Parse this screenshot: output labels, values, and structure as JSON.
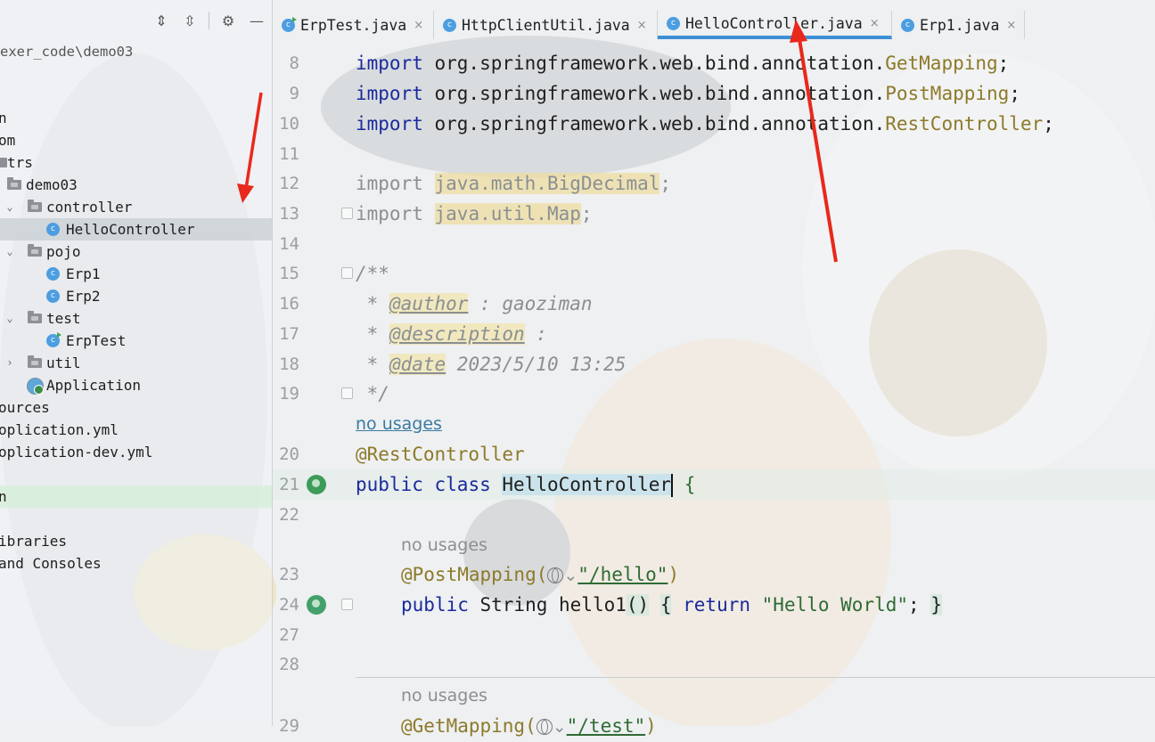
{
  "project": {
    "path": "exer_code\\demo03",
    "toolbar": {
      "expand_icon": "expand-all-icon",
      "collapse_icon": "collapse-all-icon",
      "settings_icon": "gear-icon",
      "hide_icon": "minimize-icon"
    },
    "tree": [
      {
        "label": "n",
        "depth": 0
      },
      {
        "label": "om",
        "depth": 0
      },
      {
        "label": "trs",
        "depth": 0
      },
      {
        "label": "demo03",
        "depth": 0
      },
      {
        "label": "controller",
        "depth": 1
      },
      {
        "label": "HelloController",
        "depth": 2
      },
      {
        "label": "pojo",
        "depth": 1
      },
      {
        "label": "Erp1",
        "depth": 2
      },
      {
        "label": "Erp2",
        "depth": 2
      },
      {
        "label": "test",
        "depth": 1
      },
      {
        "label": "ErpTest",
        "depth": 2
      },
      {
        "label": "util",
        "depth": 1
      },
      {
        "label": "Application",
        "depth": 1
      },
      {
        "label": "ources",
        "depth": 0
      },
      {
        "label": "oplication.yml",
        "depth": 0
      },
      {
        "label": "oplication-dev.yml",
        "depth": 0
      },
      {
        "label": "",
        "depth": 0
      },
      {
        "label": "n",
        "depth": 0
      },
      {
        "label": "",
        "depth": 0
      },
      {
        "label": "ibraries",
        "depth": 0
      },
      {
        "label": "and Consoles",
        "depth": 0
      }
    ]
  },
  "tabs": [
    {
      "label": "ErpTest.java",
      "icon": "test-class-icon",
      "close": "×"
    },
    {
      "label": "HttpClientUtil.java",
      "icon": "class-icon",
      "close": "×"
    },
    {
      "label": "HelloController.java",
      "icon": "class-icon",
      "close": "×",
      "active": true
    },
    {
      "label": "Erp1.java",
      "icon": "class-icon",
      "close": "×"
    }
  ],
  "editor": {
    "class_icon_letter": "c",
    "usages_hint": "no usages",
    "lines": {
      "l8": {
        "num": "8",
        "kw": "import",
        "pkg": " org.springframework.web.bind.annotation.",
        "cls": "GetMapping",
        "end": ";"
      },
      "l9": {
        "num": "9",
        "kw": "import",
        "pkg": " org.springframework.web.bind.annotation.",
        "cls": "PostMapping",
        "end": ";"
      },
      "l10": {
        "num": "10",
        "kw": "import",
        "pkg": " org.springframework.web.bind.annotation.",
        "cls": "RestController",
        "end": ";"
      },
      "l11": {
        "num": "11"
      },
      "l12": {
        "num": "12",
        "kw": "import",
        "path": "java.math.BigDecimal",
        "end": ";"
      },
      "l13": {
        "num": "13",
        "kw": "import",
        "path": "java.util.Map",
        "end": ";"
      },
      "l14": {
        "num": "14"
      },
      "l15": {
        "num": "15",
        "text": "/**"
      },
      "l16": {
        "num": "16",
        "prefix": " * ",
        "tag": "@author",
        "value": " : gaoziman"
      },
      "l17": {
        "num": "17",
        "prefix": " * ",
        "tag": "@description",
        "value": " :"
      },
      "l18": {
        "num": "18",
        "prefix": " * ",
        "tag": "@date",
        "value": " 2023/5/10 13:25"
      },
      "l19": {
        "num": "19",
        "text": " */"
      },
      "l20": {
        "num": "20",
        "annotation": "@RestController"
      },
      "l21": {
        "num": "21",
        "kw1": "public",
        "kw2": "class",
        "name": "HelloController",
        "brace": "{"
      },
      "l22": {
        "num": "22"
      },
      "l23": {
        "num": "23",
        "annotation": "@PostMapping(",
        "arrow": "⌄",
        "url": "\"/hello\"",
        "close": ")"
      },
      "l24": {
        "num": "24",
        "kw1": "public",
        "type": " String ",
        "method": "hello1",
        "parens": "()",
        "open": "{",
        "kw2": "return",
        "str": "\"Hello World\"",
        "semi": ";",
        "close": "}"
      },
      "l27": {
        "num": "27"
      },
      "l28": {
        "num": "28"
      },
      "l29": {
        "num": "29",
        "annotation": "@GetMapping(",
        "arrow": "⌄",
        "url": "\"/test\"",
        "close": ")"
      }
    }
  }
}
